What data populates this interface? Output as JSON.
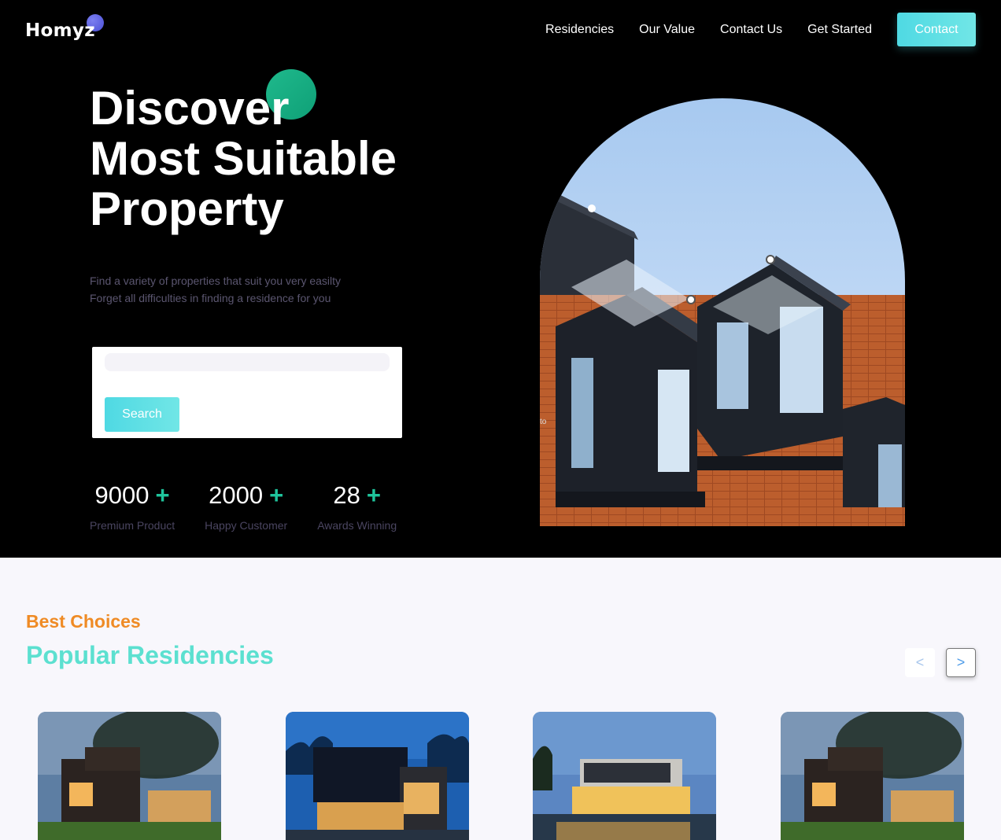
{
  "brand": {
    "name": "Homyz"
  },
  "nav": {
    "links": [
      "Residencies",
      "Our Value",
      "Contact Us",
      "Get Started"
    ],
    "contact_label": "Contact"
  },
  "hero": {
    "title_lines": [
      "Discover",
      "Most Suitable",
      "Property"
    ],
    "description_lines": [
      "Find a variety of properties that suit you very easilty",
      "Forget all difficulties in finding a residence for you"
    ],
    "search": {
      "placeholder": "",
      "value": "",
      "button_label": "Search"
    },
    "stats": [
      {
        "value": "9000",
        "suffix": "+",
        "label": "Premium Product"
      },
      {
        "value": "2000",
        "suffix": "+",
        "label": "Happy Customer"
      },
      {
        "value": "28",
        "suffix": "+",
        "label": "Awards Winning"
      }
    ],
    "image_stray_text": "to"
  },
  "popular": {
    "tag": "Best Choices",
    "title": "Popular Residencies",
    "prev_label": "<",
    "next_label": ">",
    "cards": [
      {
        "image": "modern-house-with-tree"
      },
      {
        "image": "dark-cube-house-night"
      },
      {
        "image": "lit-villa-with-pool"
      },
      {
        "image": "modern-house-with-tree"
      }
    ]
  },
  "colors": {
    "accent_cyan": "#5ce0d0",
    "accent_orange": "#ef8b25",
    "accent_green": "#1fc49c",
    "brand_dot": "#5b60e0"
  }
}
